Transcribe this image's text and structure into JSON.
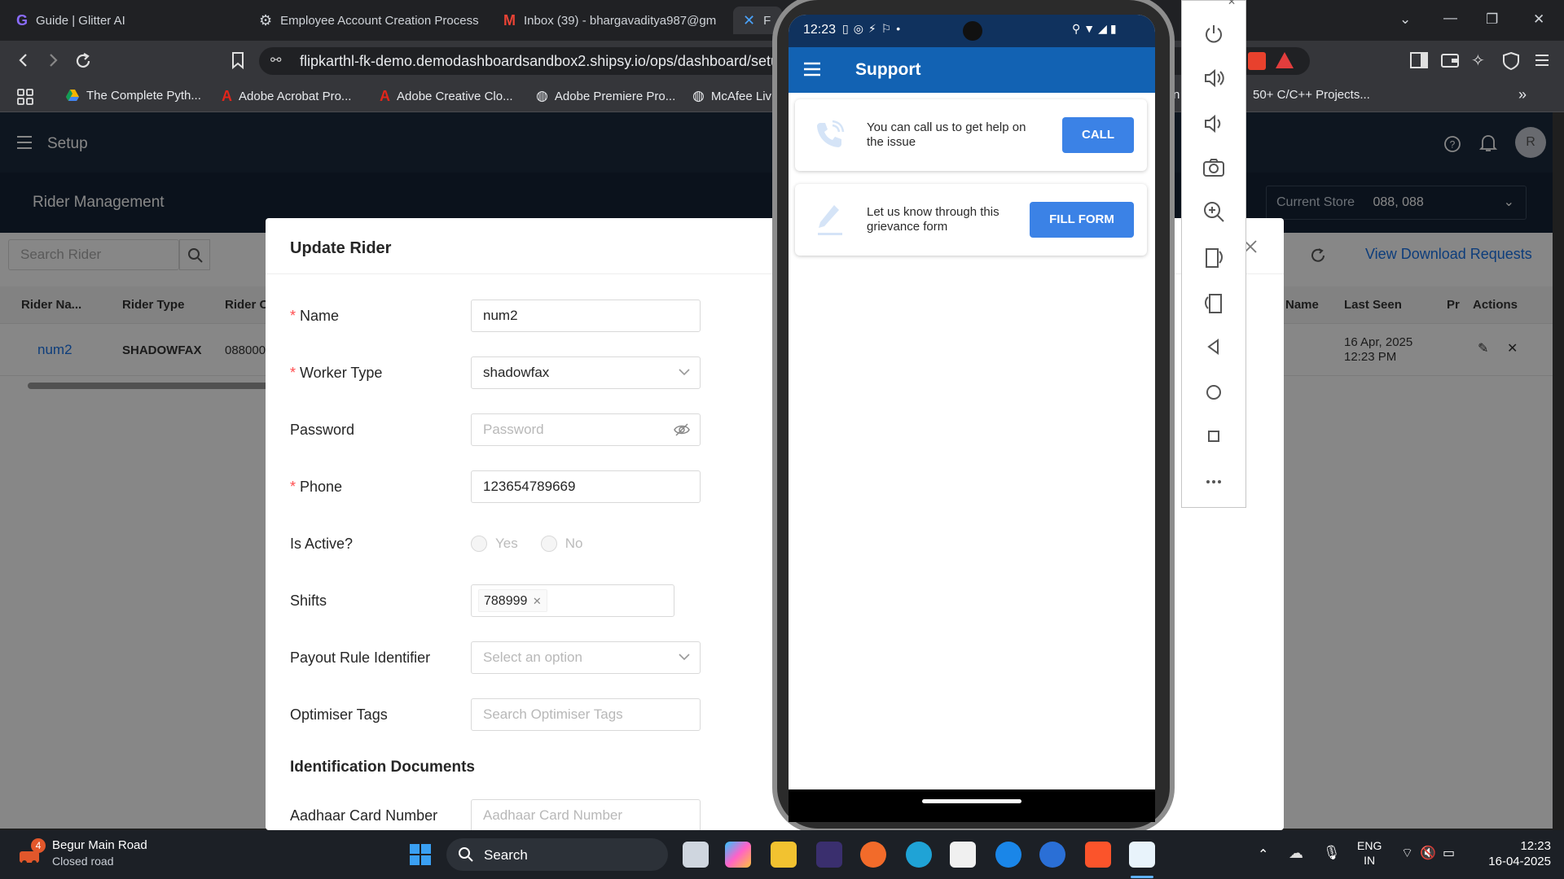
{
  "browser": {
    "tabs": [
      {
        "title": "Guide | Glitter AI"
      },
      {
        "title": "Employee Account Creation Process"
      },
      {
        "title": "Inbox (39) - bhargavaditya987@gm"
      },
      {
        "title": "F"
      }
    ],
    "url": "flipkarthl-fk-demo.demodashboardsandbox2.shipsy.io/ops/dashboard/setu",
    "bookmarks": [
      {
        "label": "The Complete Pyth..."
      },
      {
        "label": "Adobe Acrobat Pro..."
      },
      {
        "label": "Adobe Creative Clo..."
      },
      {
        "label": "Adobe Premiere Pro..."
      },
      {
        "label": "McAfee Liv"
      },
      {
        "label": "n"
      },
      {
        "label": "50+ C/C++ Projects..."
      }
    ],
    "more_bookmarks": "»"
  },
  "app": {
    "header_title": "Setup",
    "avatar_initial": "R",
    "section_title": "Rider Management",
    "current_store_label": "Current Store",
    "current_store_value": "088, 088",
    "search_placeholder": "Search Rider",
    "view_download_requests": "View Download Requests",
    "table": {
      "headers": [
        "Rider Na...",
        "Rider Type",
        "Rider C",
        "Name",
        "Last Seen",
        "Pr",
        "Actions"
      ],
      "row": {
        "name": "num2",
        "type": "SHADOWFAX",
        "code": "088000",
        "last_seen_date": "16 Apr, 2025",
        "last_seen_time": "12:23 PM"
      }
    }
  },
  "modal": {
    "title": "Update Rider",
    "fields": {
      "name_label": "Name",
      "name_value": "num2",
      "worker_type_label": "Worker Type",
      "worker_type_value": "shadowfax",
      "password_label": "Password",
      "password_placeholder": "Password",
      "phone_label": "Phone",
      "phone_value": "123654789669",
      "is_active_label": "Is Active?",
      "yes_label": "Yes",
      "no_label": "No",
      "shifts_label": "Shifts",
      "shift_tag": "788999",
      "payout_label": "Payout Rule Identifier",
      "payout_placeholder": "Select an option",
      "optimiser_label": "Optimiser Tags",
      "optimiser_placeholder": "Search Optimiser Tags",
      "id_docs_heading": "Identification Documents",
      "aadhaar_label": "Aadhaar Card Number",
      "aadhaar_placeholder": "Aadhaar Card Number"
    }
  },
  "phone": {
    "time": "12:23",
    "app_title": "Support",
    "call_text": "You can call us to get help on the issue",
    "call_button": "CALL",
    "form_text": "Let us know through this grievance form",
    "form_button": "FILL FORM"
  },
  "taskbar": {
    "weather_title": "Begur Main Road",
    "weather_sub": "Closed road",
    "weather_badge": "4",
    "search_label": "Search",
    "lang_top": "ENG",
    "lang_bottom": "IN",
    "time": "12:23",
    "date": "16-04-2025"
  }
}
